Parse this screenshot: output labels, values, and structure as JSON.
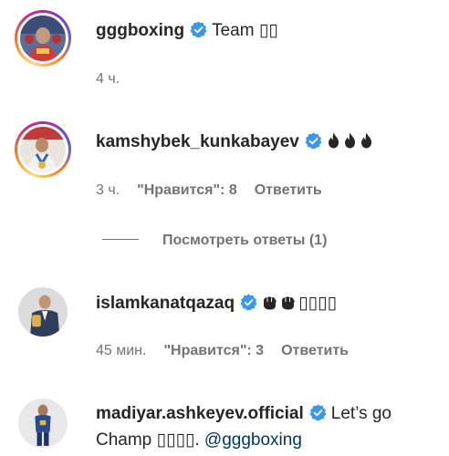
{
  "comments": [
    {
      "username": "gggboxing",
      "text": "Team ▯▯",
      "time": "4 ч.",
      "likes": "",
      "reply": ""
    },
    {
      "username": "kamshybek_kunkabayev",
      "text": "",
      "emoji_icons": [
        "fire-icon",
        "fire-icon",
        "fire-icon"
      ],
      "time": "3 ч.",
      "likes": "\"Нравится\": 8",
      "reply": "Ответить"
    },
    {
      "username": "islamkanatqazaq",
      "text": "▯▯▯▯",
      "emoji_icons": [
        "fist-icon",
        "fist-icon"
      ],
      "time": "45 мин.",
      "likes": "\"Нравится\": 3",
      "reply": "Ответить"
    },
    {
      "username": "madiyar.ashkeyev.official",
      "text_line1": "Let’s go",
      "text_line2": "Champ ▯▯▯▯.",
      "mention": "@gggboxing"
    }
  ],
  "view_replies": "Посмотреть ответы (1)",
  "colors": {
    "text": "#262626",
    "muted": "#737373",
    "verified": "#3897f0",
    "mention": "#00376b"
  }
}
